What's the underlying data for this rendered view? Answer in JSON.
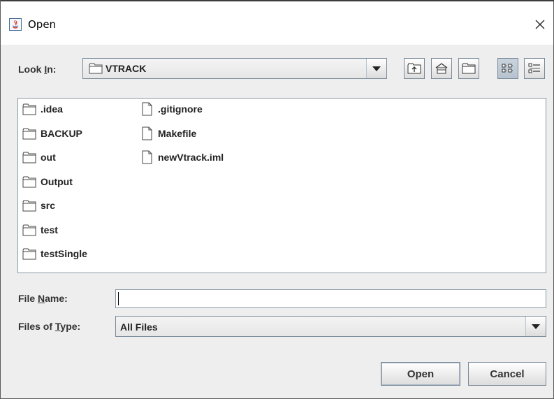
{
  "window": {
    "title": "Open"
  },
  "look_in": {
    "label_pre": "Look ",
    "label_mnemonic": "I",
    "label_post": "n:",
    "value": "VTRACK"
  },
  "toolbar": {
    "buttons": [
      {
        "name": "up-one-level",
        "icon": "folder-up-icon"
      },
      {
        "name": "home",
        "icon": "home-icon"
      },
      {
        "name": "new-folder",
        "icon": "new-folder-icon"
      },
      {
        "name": "list-view",
        "icon": "list-view-icon",
        "pressed": true
      },
      {
        "name": "details-view",
        "icon": "details-view-icon"
      }
    ]
  },
  "file_list": {
    "columns": [
      [
        {
          "name": ".idea",
          "type": "folder"
        },
        {
          "name": "BACKUP",
          "type": "folder"
        },
        {
          "name": "out",
          "type": "folder"
        },
        {
          "name": "Output",
          "type": "folder"
        },
        {
          "name": "src",
          "type": "folder"
        },
        {
          "name": "test",
          "type": "folder"
        },
        {
          "name": "testSingle",
          "type": "folder"
        }
      ],
      [
        {
          "name": ".gitignore",
          "type": "file"
        },
        {
          "name": "Makefile",
          "type": "file"
        },
        {
          "name": "newVtrack.iml",
          "type": "file"
        }
      ]
    ]
  },
  "file_name": {
    "label_pre": "File ",
    "label_mnemonic": "N",
    "label_post": "ame:",
    "value": ""
  },
  "file_type": {
    "label_pre": "Files of ",
    "label_mnemonic": "T",
    "label_post": "ype:",
    "value": "All Files"
  },
  "actions": {
    "open_label": "Open",
    "cancel_label": "Cancel"
  },
  "colors": {
    "window_bg": "#eeeeee",
    "border": "#7a8a99",
    "pressed": "#b6c3cf"
  }
}
